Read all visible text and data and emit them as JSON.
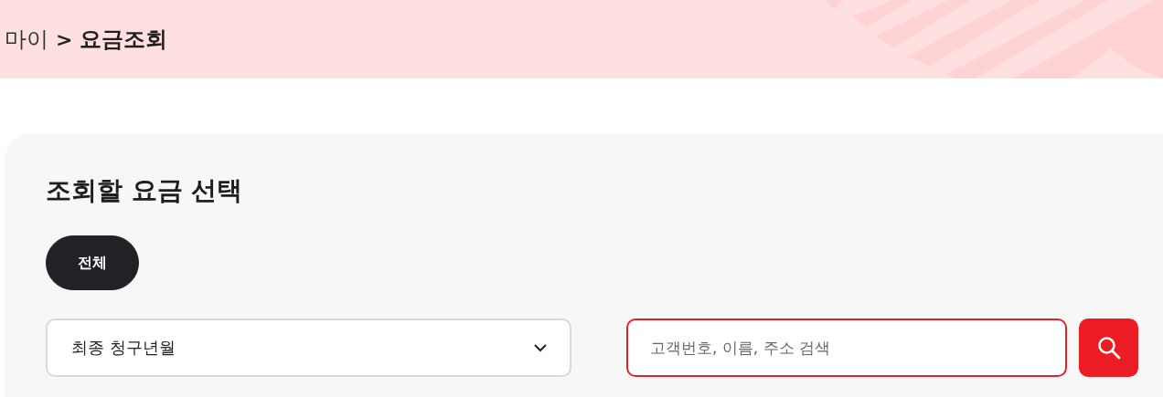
{
  "breadcrumb": {
    "parent": "마이",
    "separator": ">",
    "current": "요금조회"
  },
  "panel": {
    "title": "조회할 요금 선택",
    "filters": [
      {
        "label": "전체",
        "selected": true
      }
    ],
    "period_select": {
      "value": "최종 청구년월"
    },
    "search": {
      "placeholder": "고객번호, 이름, 주소 검색"
    }
  }
}
